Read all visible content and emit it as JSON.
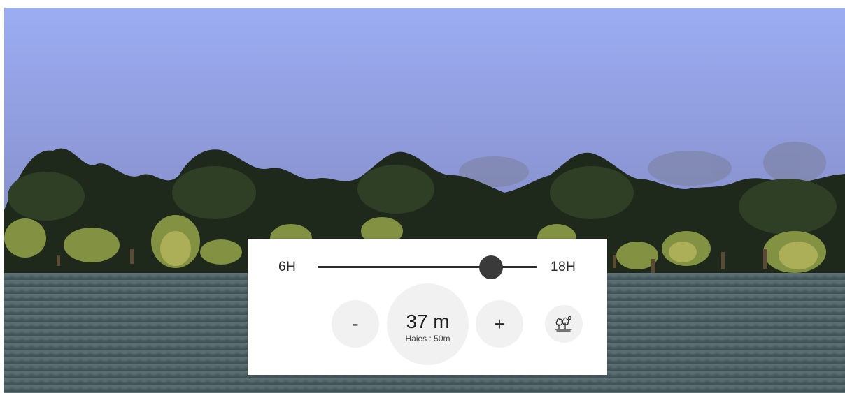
{
  "time_slider": {
    "start_label": "6H",
    "end_label": "18H",
    "current_fraction": 0.79
  },
  "distance": {
    "decrease_label": "-",
    "increase_label": "+",
    "value": "37 m",
    "hedge_length": "Haies : 50m"
  },
  "icons": {
    "layers_toggle": "trees-icon"
  },
  "colors": {
    "sky_top": "#9aabf0",
    "sky_bottom": "#6f7aa8",
    "hedge_dark": "#1f2a1c",
    "hedge_light": "#8a9a48",
    "ground": "#4f6468",
    "panel_bg": "#ffffff",
    "button_bg": "#f1f1f1",
    "slider": "#2b2b2b"
  }
}
